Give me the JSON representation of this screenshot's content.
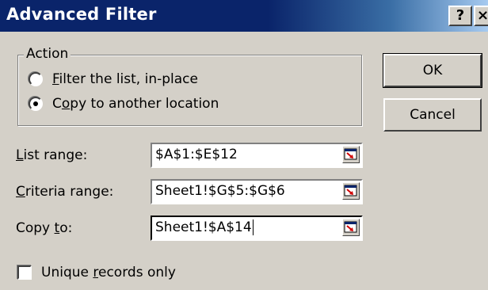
{
  "window": {
    "title": "Advanced Filter",
    "help_label": "?",
    "close_label": "×"
  },
  "action_group": {
    "legend": "Action",
    "options": [
      {
        "prefix": "",
        "mnemonic": "F",
        "rest": "ilter the list, in-place",
        "checked": false
      },
      {
        "prefix": "C",
        "mnemonic": "o",
        "rest": "py to another location",
        "checked": true
      }
    ]
  },
  "buttons": {
    "ok_label": "OK",
    "cancel_label": "Cancel"
  },
  "fields": {
    "list_range": {
      "label_mnemonic": "L",
      "label_rest": "ist range:",
      "value": "$A$1:$E$12"
    },
    "criteria_range": {
      "label_mnemonic": "C",
      "label_rest": "riteria range:",
      "value": "Sheet1!$G$5:$G$6"
    },
    "copy_to": {
      "label_prefix": "Copy ",
      "label_mnemonic": "t",
      "label_rest": "o:",
      "value": "Sheet1!$A$14"
    }
  },
  "unique_records": {
    "label_prefix": "Unique ",
    "label_mnemonic": "r",
    "label_rest": "ecords only",
    "checked": false
  },
  "icons": {
    "collapse_dialog": "collapse-dialog-icon"
  }
}
